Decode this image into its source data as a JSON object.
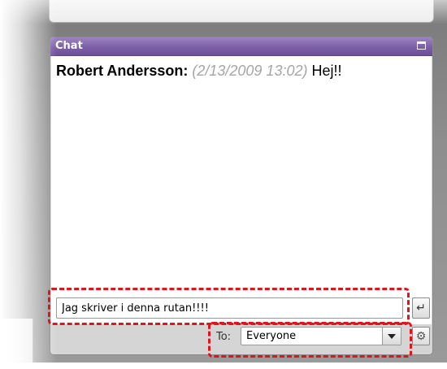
{
  "chat": {
    "title": "Chat",
    "messages": [
      {
        "sender": "Robert Andersson:",
        "timestamp": "(2/13/2009 13:02)",
        "text": "Hej!!"
      }
    ],
    "input": {
      "value": "Jag skriver i denna rutan!!!!"
    },
    "send_icon": "enter-icon",
    "recipient": {
      "label": "To:",
      "selected": "Everyone"
    },
    "settings_icon": "gear-icon"
  },
  "colors": {
    "titlebar": "#7c5fa8",
    "highlight": "#e0141b",
    "timestamp": "#a5a5a5"
  }
}
